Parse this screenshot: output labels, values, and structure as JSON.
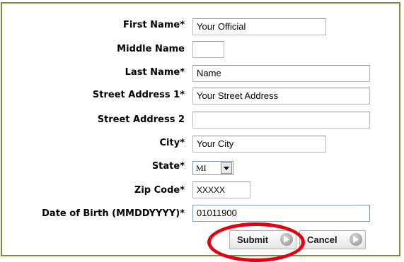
{
  "form": {
    "first_name": {
      "label": "First Name*",
      "value": "Your Official"
    },
    "middle_name": {
      "label": "Middle Name",
      "value": ""
    },
    "last_name": {
      "label": "Last Name*",
      "value": "Name"
    },
    "street1": {
      "label": "Street Address 1*",
      "value": "Your Street Address"
    },
    "street2": {
      "label": "Street Address 2",
      "value": ""
    },
    "city": {
      "label": "City*",
      "value": "Your City"
    },
    "state": {
      "label": "State*",
      "value": "MI"
    },
    "zip": {
      "label": "Zip Code*",
      "value": "XXXXX"
    },
    "dob": {
      "label": "Date of Birth (MMDDYYYY)*",
      "value": "01011900"
    }
  },
  "buttons": {
    "submit": "Submit",
    "cancel": "Cancel"
  },
  "colors": {
    "frame_border": "#7a8b3d",
    "highlight_ring": "#e3000f"
  },
  "icons": {
    "submit": "arrow-right-circle-icon",
    "cancel": "arrow-right-circle-icon",
    "select": "chevron-down-icon"
  }
}
